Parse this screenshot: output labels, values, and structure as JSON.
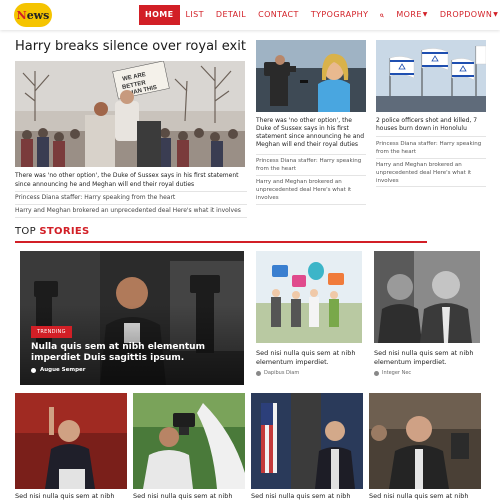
{
  "logo": {
    "text_first": "N",
    "text_rest": "ews"
  },
  "nav": {
    "items": [
      {
        "label": "HOME",
        "active": true
      },
      {
        "label": "LIST"
      },
      {
        "label": "DETAIL"
      },
      {
        "label": "CONTACT"
      },
      {
        "label": "TYPOGRAPHY"
      }
    ],
    "search_icon": "search-icon",
    "more_label": "MORE",
    "dropdown_label": "DROPDOWN",
    "accent": "#d21f26"
  },
  "lead": {
    "title": "Harry breaks silence over royal exit",
    "text": "There was 'no other option', the Duke of Sussex says in his first statement since announcing he and Meghan will end their royal duties",
    "links": [
      "Princess Diana staffer: Harry speaking from the heart",
      "Harry and Meghan brokered an unprecedented deal Here's what it involves"
    ]
  },
  "side_middle": {
    "text": "There was 'no other option', the Duke of Sussex says in his first statement since announcing he and Meghan will end their royal duties",
    "links": [
      "Princess Diana staffer: Harry speaking from the heart",
      "Harry and Meghan brokered an unprecedented deal Here's what it involves"
    ]
  },
  "side_right": {
    "text": "2 police officers shot and killed, 7 houses burn down in Honolulu",
    "links": [
      "Princess Diana staffer: Harry speaking from the heart",
      "Harry and Meghan brokered an unprecedented deal Here's what it involves"
    ]
  },
  "top_stories": {
    "title_first": "TOP",
    "title_second": "STORIES",
    "feature": {
      "badge": "TRENDING",
      "title": "Nulla quis sem at nibh elementum imperdiet Duis sagittis ipsum.",
      "author": "Augue Semper"
    },
    "cards": [
      {
        "title": "Sed nisi nulla quis sem at nibh elementum imperdiet.",
        "author": "Dapibus Diam"
      },
      {
        "title": "Sed nisi nulla quis sem at nibh elementum imperdiet.",
        "author": "Integer Nec"
      }
    ],
    "bottom": [
      {
        "title": "Sed nisi nulla quis sem at nibh"
      },
      {
        "title": "Sed nisi nulla quis sem at nibh"
      },
      {
        "title": "Sed nisi nulla quis sem at nibh"
      },
      {
        "title": "Sed nisi nulla quis sem at nibh"
      }
    ]
  }
}
